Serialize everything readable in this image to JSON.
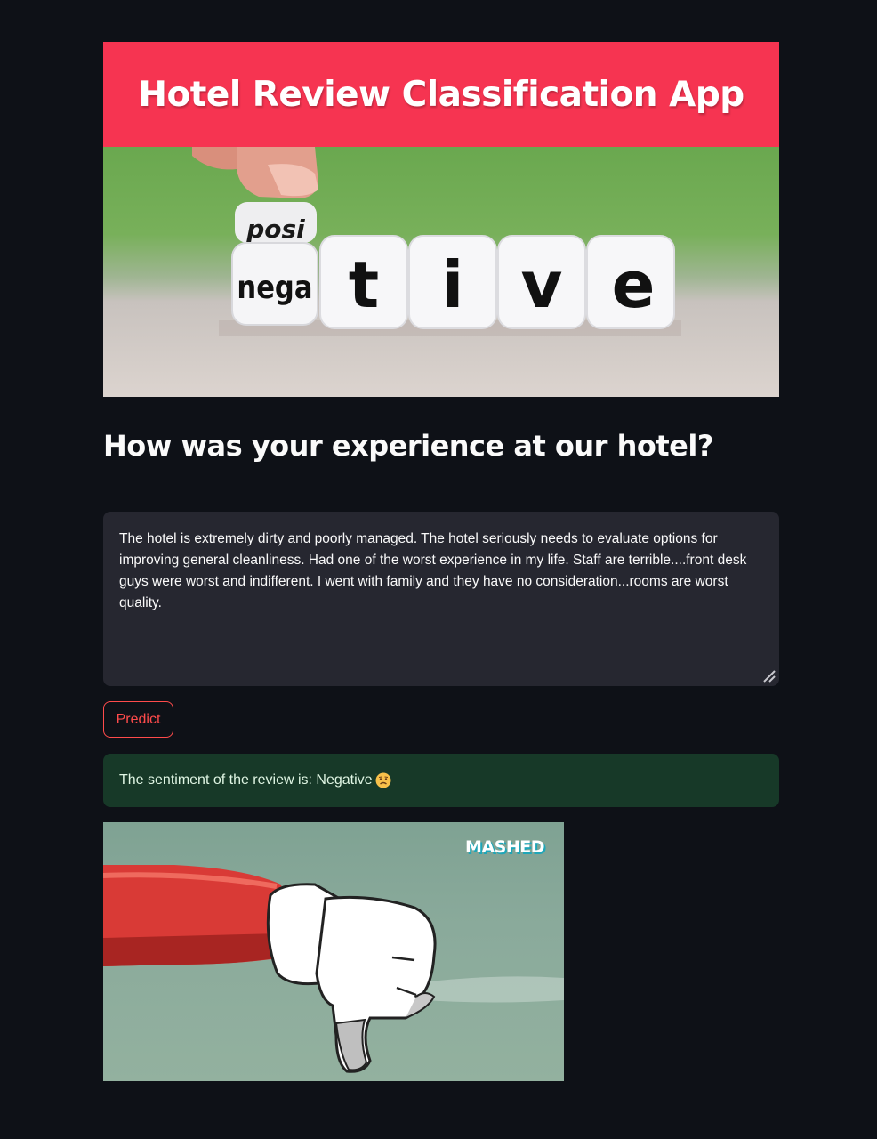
{
  "app": {
    "title": "Hotel Review Classification App"
  },
  "hero": {
    "die_top_label": "posi",
    "die_front_label": "nega",
    "letters": [
      "t",
      "i",
      "v",
      "e"
    ]
  },
  "form": {
    "question": "How was your experience at our hotel?",
    "review_text": "The hotel is extremely dirty and poorly managed. The hotel seriously needs to evaluate options for improving general cleanliness. Had one of the worst experience in my life. Staff are terrible....front desk guys were worst and indifferent. I went with family and they have no consideration...rooms are worst quality.",
    "predict_label": "Predict"
  },
  "result": {
    "message": "The sentiment of the review is: Negative",
    "emoji": "sad-face-emoji"
  },
  "gif": {
    "logo": "MASHED",
    "icon": "thumbs-down-hand"
  },
  "colors": {
    "background": "#0e1117",
    "banner": "#f63451",
    "accent": "#ff4b4b",
    "input_bg": "#262730",
    "success_bg": "#173928"
  }
}
